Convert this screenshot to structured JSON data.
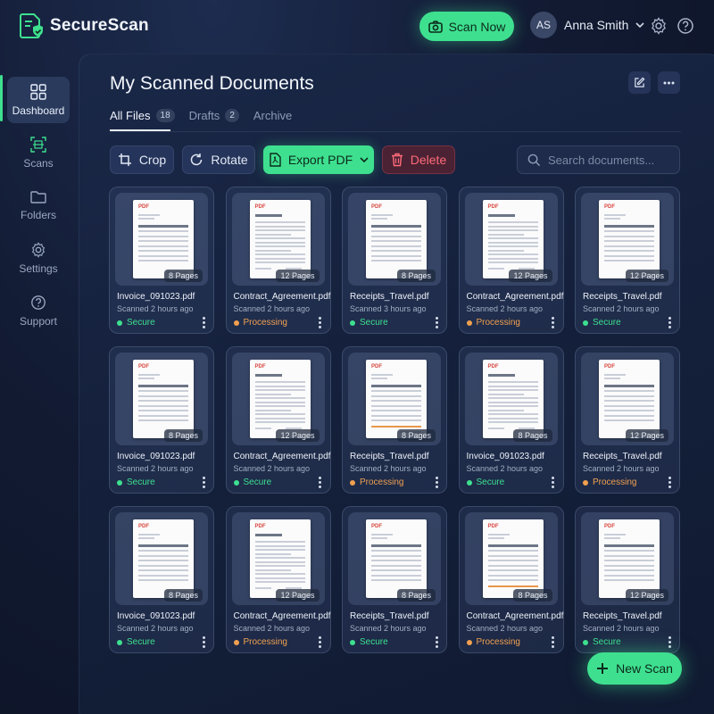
{
  "app": {
    "name": "SecureScan"
  },
  "header": {
    "scan_now_label": "Scan Now",
    "user": {
      "initials": "AS",
      "name": "Anna Smith"
    }
  },
  "sidebar": {
    "items": [
      {
        "label": "Dashboard",
        "icon": "dashboard-icon",
        "active": true
      },
      {
        "label": "Scans",
        "icon": "scan-icon",
        "active": false
      },
      {
        "label": "Folders",
        "icon": "folder-icon",
        "active": false
      },
      {
        "label": "Settings",
        "icon": "gear-icon",
        "active": false
      },
      {
        "label": "Support",
        "icon": "help-icon",
        "active": false
      }
    ]
  },
  "main": {
    "title": "My Scanned Documents",
    "tabs": [
      {
        "label": "All Files",
        "count": "18",
        "active": true
      },
      {
        "label": "Drafts",
        "count": "2",
        "active": false
      },
      {
        "label": "Archive",
        "count": "",
        "active": false
      }
    ],
    "toolbar": {
      "crop_label": "Crop",
      "rotate_label": "Rotate",
      "export_label": "Export PDF",
      "delete_label": "Delete"
    },
    "search": {
      "placeholder": "Search documents..."
    },
    "new_scan_label": "New Scan"
  },
  "colors": {
    "accent": "#3ee08f",
    "secure": "#3ee08f",
    "processing": "#f0a050",
    "danger": "#ff6b7a"
  },
  "documents": [
    {
      "name": "Invoice_091023.pdf",
      "time": "Scanned 2 hours ago",
      "status": "Secure",
      "pages": "8 Pages",
      "kind": "invoice"
    },
    {
      "name": "Contract_Agreement.pdf",
      "time": "Scanned 2 hours ago",
      "status": "Processing",
      "pages": "12 Pages",
      "kind": "contract"
    },
    {
      "name": "Receipts_Travel.pdf",
      "time": "Scanned 3 hours ago",
      "status": "Secure",
      "pages": "8 Pages",
      "kind": "invoice"
    },
    {
      "name": "Contract_Agreement.pdf",
      "time": "Scanned 2 hours ago",
      "status": "Processing",
      "pages": "12 Pages",
      "kind": "contract"
    },
    {
      "name": "Receipts_Travel.pdf",
      "time": "Scanned 2 hours ago",
      "status": "Secure",
      "pages": "12 Pages",
      "kind": "invoice"
    },
    {
      "name": "Invoice_091023.pdf",
      "time": "Scanned 2 hours ago",
      "status": "Secure",
      "pages": "8 Pages",
      "kind": "invoice"
    },
    {
      "name": "Contract_Agreement.pdf",
      "time": "Scanned 2 hours ago",
      "status": "Secure",
      "pages": "12 Pages",
      "kind": "contract"
    },
    {
      "name": "Receipts_Travel.pdf",
      "time": "Scanned 2 hours ago",
      "status": "Processing",
      "pages": "8 Pages",
      "kind": "receipt"
    },
    {
      "name": "Invoice_091023.pdf",
      "time": "Scanned 2 hours ago",
      "status": "Secure",
      "pages": "8 Pages",
      "kind": "contract"
    },
    {
      "name": "Receipts_Travel.pdf",
      "time": "Scanned 2 hours ago",
      "status": "Processing",
      "pages": "12 Pages",
      "kind": "invoice"
    },
    {
      "name": "Invoice_091023.pdf",
      "time": "Scanned 2 hours ago",
      "status": "Secure",
      "pages": "8 Pages",
      "kind": "invoice"
    },
    {
      "name": "Contract_Agreement.pdf",
      "time": "Scanned 2 hours ago",
      "status": "Processing",
      "pages": "12 Pages",
      "kind": "contract"
    },
    {
      "name": "Receipts_Travel.pdf",
      "time": "Scanned 2 hours ago",
      "status": "Secure",
      "pages": "8 Pages",
      "kind": "invoice"
    },
    {
      "name": "Contract_Agreement.pdf",
      "time": "Scanned 2 hours ago",
      "status": "Processing",
      "pages": "8 Pages",
      "kind": "receipt"
    },
    {
      "name": "Receipts_Travel.pdf",
      "time": "Scanned 2 hours ago",
      "status": "Secure",
      "pages": "12 Pages",
      "kind": "invoice"
    }
  ]
}
